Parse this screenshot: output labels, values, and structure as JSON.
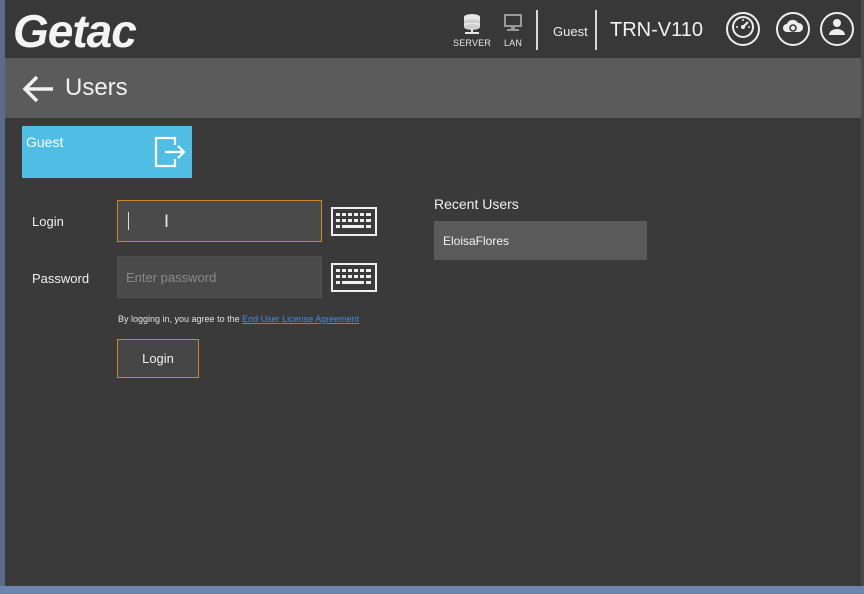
{
  "header": {
    "logo": "Getac",
    "status": [
      {
        "icon": "server-icon",
        "label": "SERVER"
      },
      {
        "icon": "lan-icon",
        "label": "LAN"
      }
    ],
    "user": "Guest",
    "device": "TRN-V110",
    "actions": [
      {
        "icon": "speedometer-icon"
      },
      {
        "icon": "cloud-sync-icon"
      },
      {
        "icon": "user-icon"
      }
    ]
  },
  "titlebar": {
    "back_icon": "arrow-left-icon",
    "title": "Users"
  },
  "guest_tile": {
    "label": "Guest",
    "icon": "logout-icon",
    "color": "#4fbde4"
  },
  "form": {
    "login_label": "Login",
    "login_value": "",
    "password_label": "Password",
    "password_placeholder": "Enter password",
    "keyboard_icon": "keyboard-icon",
    "agreement_text": "By logging in, you agree to the ",
    "agreement_link": "End User License Agreement",
    "login_button": "Login",
    "accent_color": "#d1862a"
  },
  "recent": {
    "title": "Recent Users",
    "users": [
      "EloisaFlores"
    ]
  }
}
